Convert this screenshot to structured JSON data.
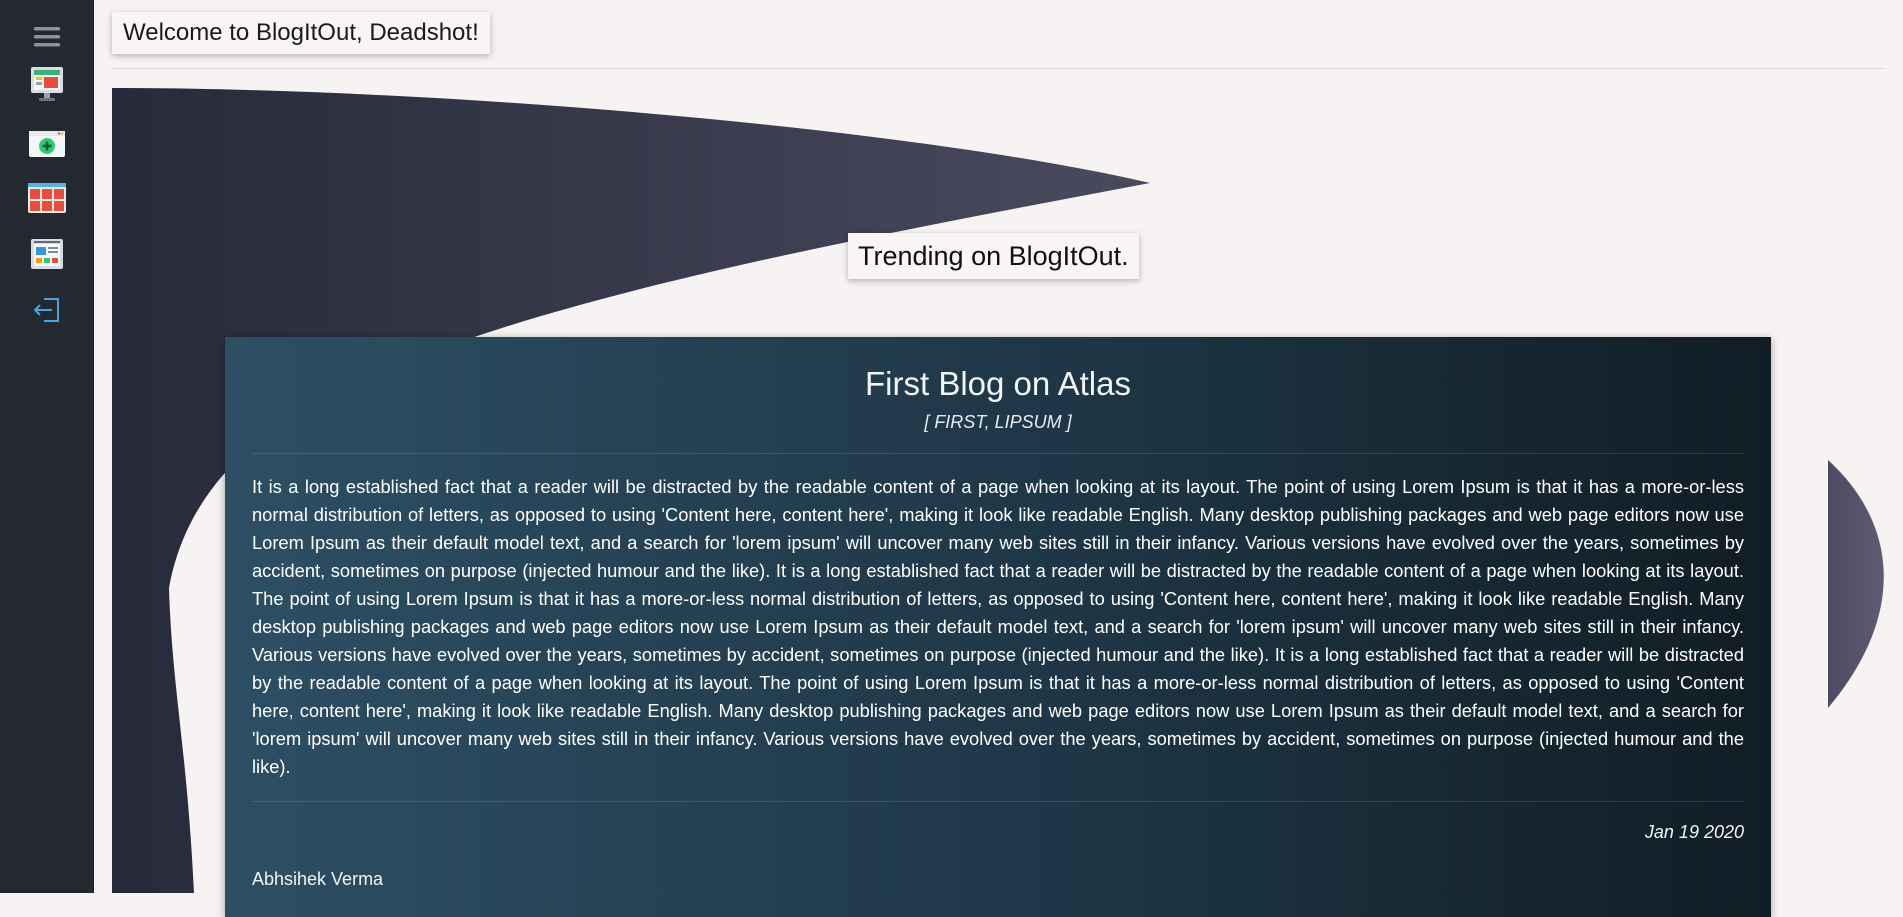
{
  "sidebar": {
    "items": [
      {
        "icon": "menu-icon"
      },
      {
        "icon": "monitor-icon"
      },
      {
        "icon": "add-post-icon"
      },
      {
        "icon": "grid-icon"
      },
      {
        "icon": "dashboard-icon"
      },
      {
        "icon": "logout-icon"
      }
    ]
  },
  "header": {
    "welcome": "Welcome to BlogItOut, Deadshot!"
  },
  "trending": {
    "label": "Trending on BlogItOut."
  },
  "post": {
    "title": "First Blog on Atlas",
    "tags": "[ FIRST, LIPSUM ]",
    "body": "It is a long established fact that a reader will be distracted by the readable content of a page when looking at its layout. The point of using Lorem Ipsum is that it has a more-or-less normal distribution of letters, as opposed to using 'Content here, content here', making it look like readable English. Many desktop publishing packages and web page editors now use Lorem Ipsum as their default model text, and a search for 'lorem ipsum' will uncover many web sites still in their infancy. Various versions have evolved over the years, sometimes by accident, sometimes on purpose (injected humour and the like). It is a long established fact that a reader will be distracted by the readable content of a page when looking at its layout. The point of using Lorem Ipsum is that it has a more-or-less normal distribution of letters, as opposed to using 'Content here, content here', making it look like readable English. Many desktop publishing packages and web page editors now use Lorem Ipsum as their default model text, and a search for 'lorem ipsum' will uncover many web sites still in their infancy. Various versions have evolved over the years, sometimes by accident, sometimes on purpose (injected humour and the like). It is a long established fact that a reader will be distracted by the readable content of a page when looking at its layout. The point of using Lorem Ipsum is that it has a more-or-less normal distribution of letters, as opposed to using 'Content here, content here', making it look like readable English. Many desktop publishing packages and web page editors now use Lorem Ipsum as their default model text, and a search for 'lorem ipsum' will uncover many web sites still in their infancy. Various versions have evolved over the years, sometimes by accident, sometimes on purpose (injected humour and the like).",
    "date": "Jan 19 2020",
    "author": "Abhsihek Verma"
  },
  "colors": {
    "sidebar_bg": "#232831",
    "page_bg": "#f7f3f2",
    "card_gradient_start": "#2d4f64",
    "card_gradient_end": "#111d25",
    "deco_shape": "#2a2e40"
  }
}
